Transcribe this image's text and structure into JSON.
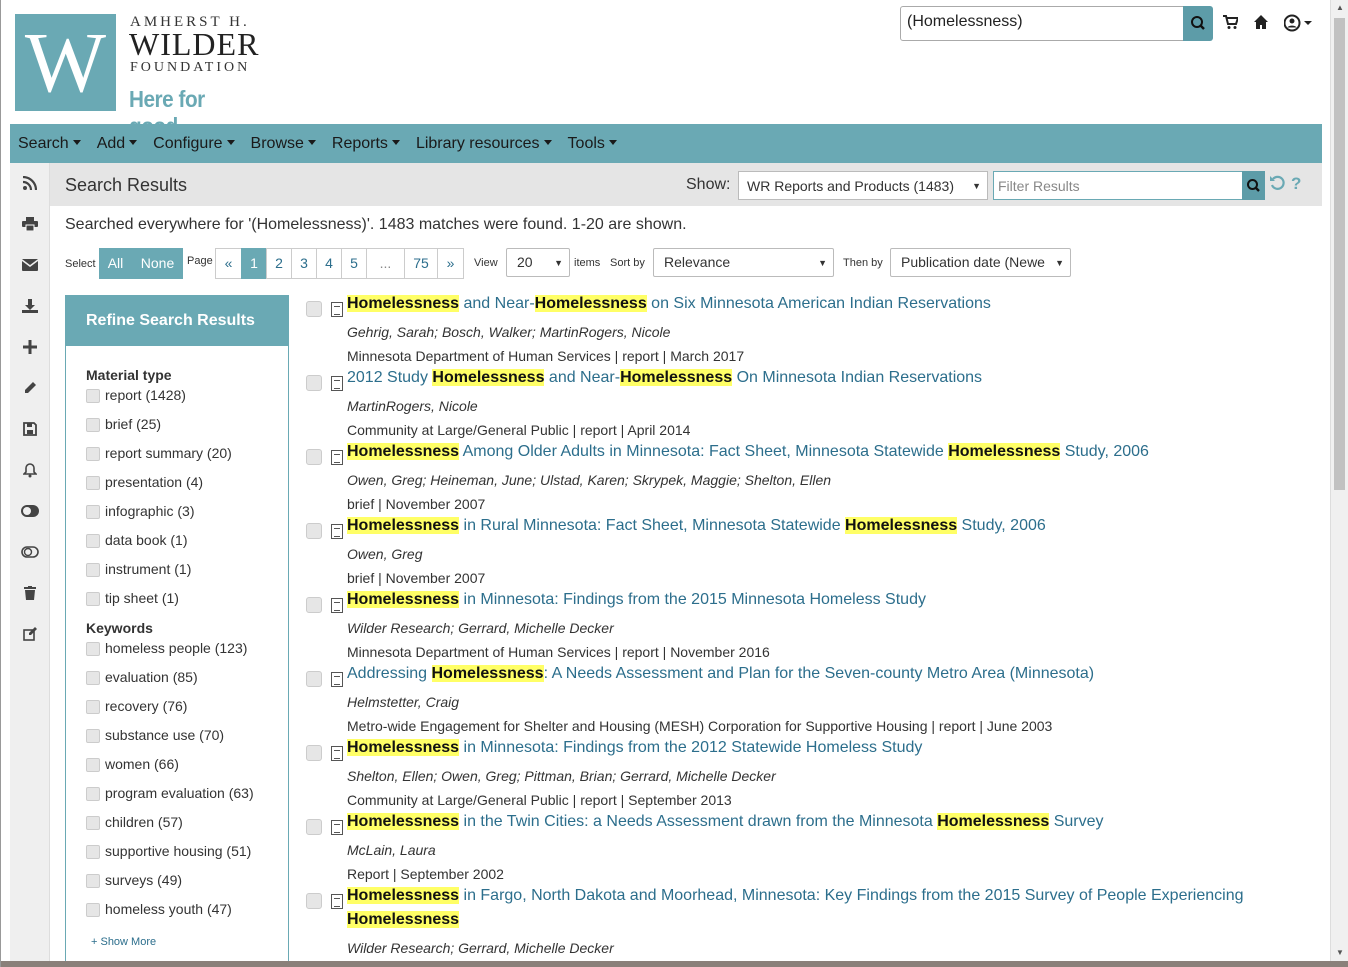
{
  "brand": {
    "line1": "AMHERST H.",
    "line2": "WILDER",
    "line3": "FOUNDATION",
    "tagline": "Here for good.",
    "mark": "W"
  },
  "top_search": {
    "value": "(Homelessness)"
  },
  "nav": [
    "Search",
    "Add",
    "Configure",
    "Browse",
    "Reports",
    "Library resources",
    "Tools"
  ],
  "results_header": {
    "title": "Search Results",
    "show_label": "Show:",
    "show_value": "WR Reports and Products (1483)",
    "filter_placeholder": "Filter Results",
    "help": "?"
  },
  "summary": "Searched everywhere for '(Homelessness)'. 1483 matches were found. 1-20 are shown.",
  "controls": {
    "select_label": "Select",
    "all": "All",
    "none": "None",
    "page_label": "Page",
    "pages": [
      "«",
      "1",
      "2",
      "3",
      "4",
      "5",
      "...",
      "75",
      "»"
    ],
    "view_label": "View",
    "view_value": "20",
    "items_label": "items",
    "sort_label": "Sort by",
    "sort_value": "Relevance",
    "then_label": "Then by",
    "then_value": "Publication date (Newe"
  },
  "refine": {
    "title": "Refine Search Results",
    "material_type_heading": "Material type",
    "material_types": [
      "report (1428)",
      "brief (25)",
      "report summary (20)",
      "presentation (4)",
      "infographic (3)",
      "data book (1)",
      "instrument (1)",
      "tip sheet (1)"
    ],
    "keywords_heading": "Keywords",
    "keywords": [
      "homeless people (123)",
      "evaluation (85)",
      "recovery (76)",
      "substance use (70)",
      "women (66)",
      "program evaluation (63)",
      "children (57)",
      "supportive housing (51)",
      "surveys (49)",
      "homeless youth (47)"
    ],
    "show_more": "+ Show More"
  },
  "results": [
    {
      "title": [
        "Homelessness",
        " and Near-",
        "Homelessness",
        " on Six Minnesota American Indian Reservations"
      ],
      "authors": "Gehrig, Sarah; Bosch, Walker; MartinRogers, Nicole",
      "pub": "Minnesota Department of Human Services | report | March 2017"
    },
    {
      "title": [
        "",
        "2012 Study ",
        "Homelessness",
        " and Near-",
        "Homelessness",
        " On Minnesota Indian Reservations"
      ],
      "authors": "MartinRogers, Nicole",
      "pub": "Community at Large/General Public | report | April 2014"
    },
    {
      "title": [
        "Homelessness",
        " Among Older Adults in Minnesota: Fact Sheet, Minnesota Statewide ",
        "Homelessness",
        " Study, 2006"
      ],
      "authors": "Owen, Greg; Heineman, June; Ulstad, Karen; Skrypek, Maggie; Shelton, Ellen",
      "pub": "brief | November 2007"
    },
    {
      "title": [
        "Homelessness",
        " in Rural Minnesota: Fact Sheet, Minnesota Statewide ",
        "Homelessness",
        " Study, 2006"
      ],
      "authors": "Owen, Greg",
      "pub": "brief | November 2007"
    },
    {
      "title": [
        "Homelessness",
        " in Minnesota: Findings from the 2015 Minnesota Homeless Study"
      ],
      "authors": "Wilder Research; Gerrard, Michelle Decker",
      "pub": "Minnesota Department of Human Services | report | November 2016"
    },
    {
      "title": [
        "",
        "Addressing ",
        "Homelessness",
        ": A Needs Assessment and Plan for the Seven-county Metro Area (Minnesota)"
      ],
      "authors": "Helmstetter, Craig",
      "pub": "Metro-wide Engagement for Shelter and Housing (MESH) Corporation for Supportive Housing | report | June 2003"
    },
    {
      "title": [
        "Homelessness",
        " in Minnesota: Findings from the 2012 Statewide Homeless Study"
      ],
      "authors": "Shelton, Ellen; Owen, Greg; Pittman, Brian; Gerrard, Michelle Decker",
      "pub": "Community at Large/General Public | report | September 2013"
    },
    {
      "title": [
        "Homelessness",
        " in the Twin Cities: a Needs Assessment drawn from the Minnesota ",
        "Homelessness",
        " Survey"
      ],
      "authors": "McLain, Laura",
      "pub": "Report | September 2002"
    },
    {
      "title": [
        "Homelessness",
        " in Fargo, North Dakota and Moorhead, Minnesota: Key Findings from the 2015 Survey of People Experiencing "
      ],
      "title2": "Homelessness",
      "authors": "Wilder Research; Gerrard, Michelle Decker",
      "pub": ""
    }
  ],
  "colors": {
    "accent": "#6aa9b4",
    "link": "#2c6e8c",
    "highlight": "#ffff66"
  }
}
